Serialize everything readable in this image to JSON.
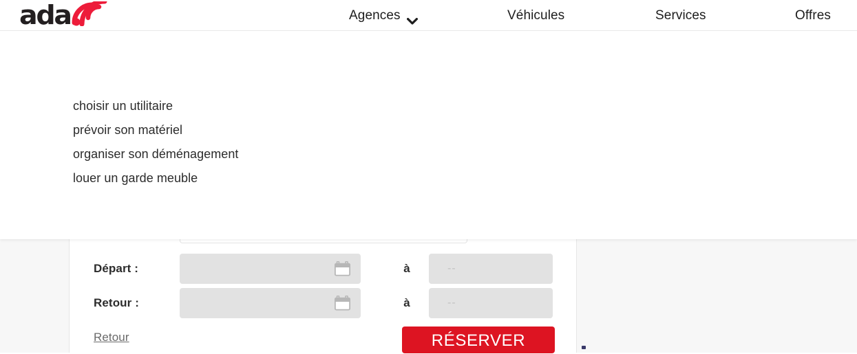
{
  "brand": {
    "name": "ada",
    "logo_icon": "ada-wifi-waves-logo",
    "wave_color": "#ed1c3a",
    "word_color": "#231f20"
  },
  "header": {
    "nav": [
      {
        "label": "Agences",
        "icon": "chevron-down-icon",
        "has_dropdown": true,
        "expanded": true
      },
      {
        "label": "Véhicules",
        "has_dropdown": false
      },
      {
        "label": "Services",
        "has_dropdown": false
      },
      {
        "label": "Offres",
        "has_dropdown": false
      }
    ]
  },
  "dropdown": {
    "items": [
      {
        "label": "choisir un utilitaire"
      },
      {
        "label": "prévoir son matériel"
      },
      {
        "label": "organiser son déménagement"
      },
      {
        "label": "louer un garde meuble"
      }
    ]
  },
  "booking_form": {
    "rows": [
      {
        "label": "Départ :",
        "date_value": "",
        "date_icon": "calendar-icon",
        "separator": "à",
        "time_value": "--"
      },
      {
        "label": "Retour :",
        "date_value": "",
        "date_icon": "calendar-icon",
        "separator": "à",
        "time_value": "--"
      }
    ],
    "back_link": "Retour",
    "submit_label": "RÉSERVER",
    "submit_color": "#dd1422"
  }
}
